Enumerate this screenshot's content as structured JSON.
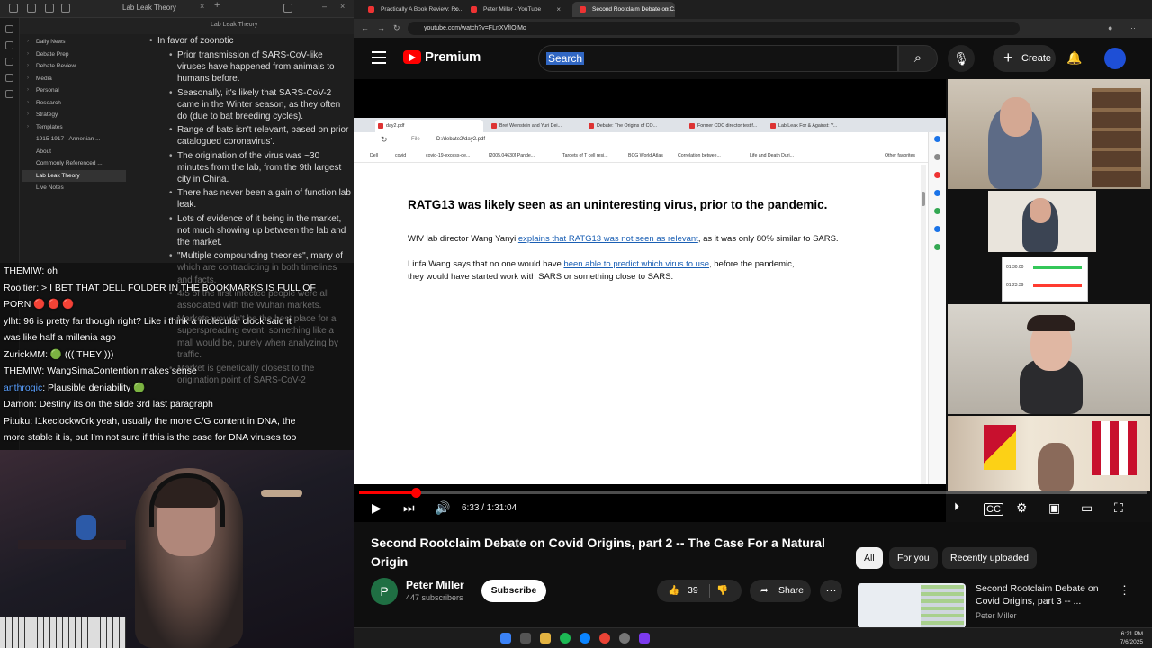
{
  "obsidian": {
    "window_title": "Lab Leak Theory",
    "tab_title": "Lab Leak Theory",
    "tree": [
      "Daily News",
      "Debate Prep",
      "Debate Review",
      "Media",
      "Personal",
      "Research",
      "Strategy",
      "Templates",
      "1915-1917 - Armenian ...",
      "About",
      "Commonly Referenced ...",
      "Lab Leak Theory",
      "Live Notes"
    ],
    "doc_heading": "In favor of zoonotic",
    "bullets": [
      "Prior transmission of SARS-CoV-like viruses have happened from animals to humans before.",
      "Seasonally, it's likely that SARS-CoV-2 came in the Winter season, as they often do (due to bat breeding cycles).",
      "Range of bats isn't relevant, based on prior catalogued coronavirus'.",
      "The origination of the virus was ~30 minutes from the lab, from the 9th largest city in China.",
      "There has never been a gain of function lab leak.",
      "Lots of evidence of it being in the market, not much showing up between the lab and the market.",
      "\"Multiple compounding theories\", many of which are contradicting in both timelines and facts.",
      "4/5 of the first infected people were all associated with the Wuhan markets.",
      "Markets wouldn't be the best place for a superspreading event, something like a mall would be, purely when analyzing by traffic.",
      "Market is genetically closest to the origination point of SARS-CoV-2"
    ]
  },
  "chat": [
    {
      "name": "THEMIW",
      "msg": ": oh"
    },
    {
      "name": "Rooitier",
      "msg": ": > I BET THAT DELL FOLDER IN THE BOOKMARKS IS FULL OF"
    },
    {
      "name": "",
      "msg": "PORN 🔴 🔴 🔴"
    },
    {
      "name": "ylht",
      "msg": ": 96 is pretty far though right? Like i think a molecular clock said it"
    },
    {
      "name": "",
      "msg": "was like half a millenia ago"
    },
    {
      "name": "ZurickMM",
      "msg": ": 🟢 ((( THEY )))"
    },
    {
      "name": "THEMIW",
      "msg": ": WangSimaContention makes sense"
    },
    {
      "name": "anthrogic",
      "msg": ": Plausible deniability 🟢",
      "blue": true
    },
    {
      "name": "Damon",
      "msg": ": Destiny its on the slide 3rd last paragraph"
    },
    {
      "name": "Pituku",
      "msg": ": l1keclockw0rk yeah, usually the more C/G content in DNA, the"
    },
    {
      "name": "",
      "msg": "more stable it is, but I'm not sure if this is the case for DNA viruses too"
    }
  ],
  "browser": {
    "tabs": [
      {
        "label": "Practically A Book Review: Ro...",
        "color": "#e33"
      },
      {
        "label": "Peter Miller - YouTube",
        "color": "#e33"
      },
      {
        "label": "Second Rootclaim Debate on C...",
        "color": "#e33"
      }
    ],
    "url": "youtube.com/watch?v=FLnXVfIOjMo"
  },
  "youtube": {
    "brand": "Premium",
    "search_text": "Search",
    "create_label": "Create",
    "video_title": "Second Rootclaim Debate on Covid Origins, part 2 -- The Case For a Natural Origin",
    "channel_initial": "P",
    "channel_name": "Peter Miller",
    "subscribers": "447 subscribers",
    "subscribe_label": "Subscribe",
    "like_count": "39",
    "share_label": "Share",
    "time_current": "6:33",
    "time_total": "1:31:04",
    "time_display": "6:33 / 1:31:04",
    "progress_fraction": 0.072,
    "chips": [
      "All",
      "For you",
      "Recently uploaded"
    ],
    "rec_title": "Second Rootclaim Debate on Covid Origins, part 3 -- ...",
    "rec_channel": "Peter Miller"
  },
  "shared_screen": {
    "tabs": [
      "day2.pdf",
      "Bret Weinstein and Yuri Dei...",
      "Debate: The Origins of CO...",
      "Former CDC director testif...",
      "Lab Leak For & Against: Y..."
    ],
    "file_label": "File",
    "path": "D:/debate2/day2.pdf",
    "bookmarks": [
      "Dell",
      "covid",
      "covid-19-excess-de...",
      "[2005.04630] Pande...",
      "Targets of T cell resi...",
      "BCG World Atlas",
      "Correlation betwee...",
      "Life and Death Duri...",
      "Other favorites"
    ],
    "pdf_title": "RATG13 was likely seen as an uninteresting virus, prior to the pandemic.",
    "p1_pre": "WIV lab director Wang Yanyi ",
    "p1_link": "explains that RATG13 was not seen as relevant",
    "p1_post": ", as it was only 80% similar to SARS.",
    "p2_pre": "Linfa Wang says that no one would have ",
    "p2_link": "been able to predict which virus to use",
    "p2_post": ", before the pandemic,",
    "p2_line2": "they would have started work with SARS or something close to SARS."
  },
  "timer": {
    "a": "01:30:00",
    "b": "01:23:39"
  },
  "clock": {
    "time": "6:21 PM",
    "date": "7/6/2025"
  }
}
